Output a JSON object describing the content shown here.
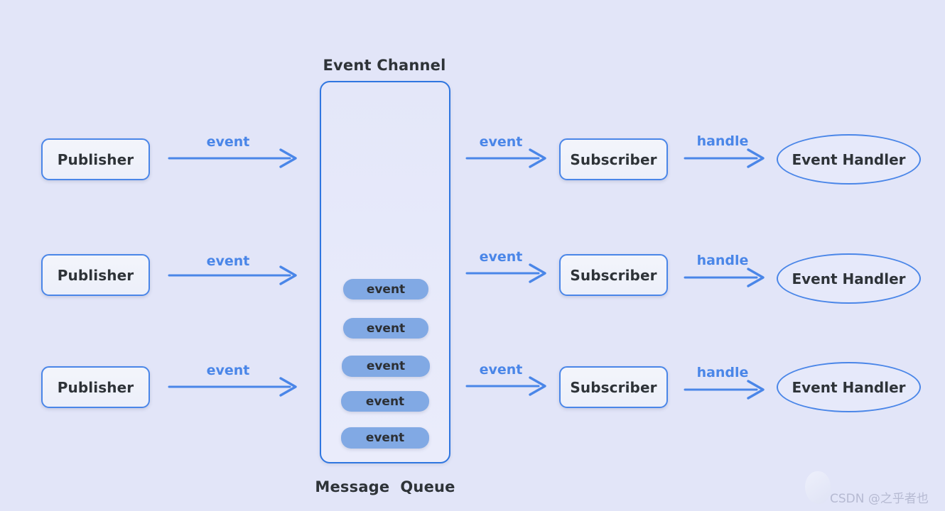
{
  "background_color": "#e2e5f8",
  "accent_color": "#4a86e8",
  "channel_border_color": "#2f76e0",
  "pill_color": "#81a9e4",
  "text_color": "#2e3338",
  "titles": {
    "channel_title": "Event Channel",
    "queue_title": "Message  Queue"
  },
  "rows": [
    {
      "publisher_label": "Publisher",
      "publish_arrow_label": "event",
      "deliver_arrow_label": "event",
      "subscriber_label": "Subscriber",
      "handle_arrow_label": "handle",
      "handler_label": "Event Handler"
    },
    {
      "publisher_label": "Publisher",
      "publish_arrow_label": "event",
      "deliver_arrow_label": "event",
      "subscriber_label": "Subscriber",
      "handle_arrow_label": "handle",
      "handler_label": "Event Handler"
    },
    {
      "publisher_label": "Publisher",
      "publish_arrow_label": "event",
      "deliver_arrow_label": "event",
      "subscriber_label": "Subscriber",
      "handle_arrow_label": "handle",
      "handler_label": "Event Handler"
    }
  ],
  "queue_items": [
    {
      "label": "event"
    },
    {
      "label": "event"
    },
    {
      "label": "event"
    },
    {
      "label": "event"
    },
    {
      "label": "event"
    }
  ],
  "watermark": {
    "text": "CSDN @之乎者也"
  }
}
